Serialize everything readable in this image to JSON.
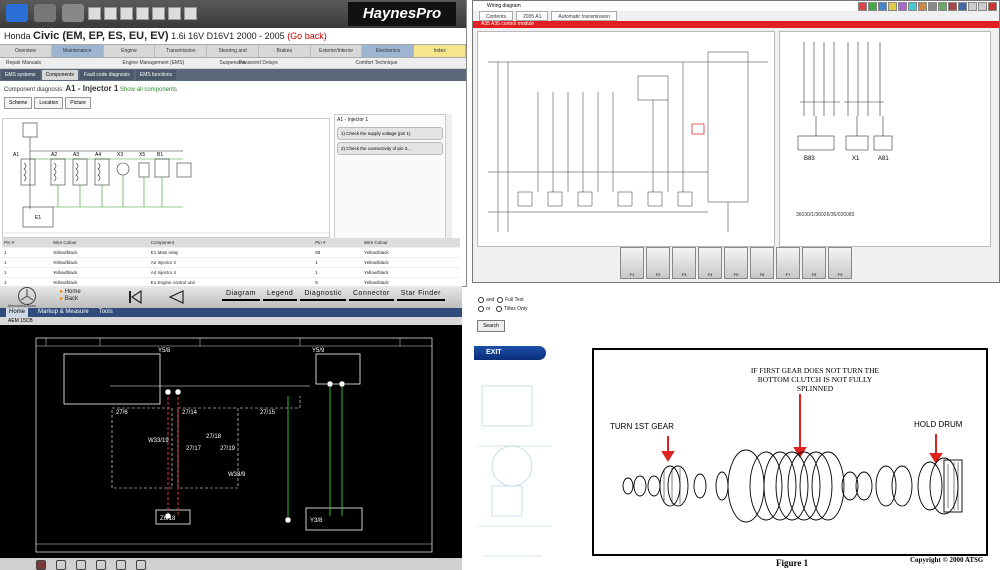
{
  "haynes": {
    "logo": "HaynesPro",
    "vehicle_prefix": "Honda",
    "vehicle_model": "Civic (EM, EP, ES, EU, EV)",
    "vehicle_detail": "1.6i 16V D16V1 2000 - 2005",
    "change_link": "(Go back)",
    "tabs": [
      "Overview",
      "Maintenance",
      "Engine",
      "Transmission",
      "Steering and Suspension",
      "Brakes",
      "Exterior/Interior",
      "Electronics",
      "Index"
    ],
    "subtabs": [
      "Repair Manuals",
      "Engine Management (EMS)",
      "Password Delays",
      "Comfort Technique"
    ],
    "subtabs2": [
      "EMS systems",
      "Components",
      "Fault code diagnosis",
      "EMS functions"
    ],
    "component_label": "Component diagnosis:",
    "component_value": "A1 - Injector 1",
    "show_all": "Show all components",
    "view_buttons": [
      "Scheme",
      "Location",
      "Picture"
    ],
    "diagram_labels": [
      "A1",
      "A2",
      "A3",
      "A4",
      "X3",
      "X5",
      "B1",
      "E1"
    ],
    "panel_title": "A1 - Injector 1",
    "steps": [
      "1) Check the supply voltage (pin 1)",
      "2) Check the connectivity of pin 3..."
    ],
    "table_header": [
      "Pin #",
      "Wire Colour",
      "Component",
      "Pin #",
      "Wire Colour"
    ],
    "table_rows": [
      [
        "1",
        "Yellow/black",
        "E1 Main relay",
        "85",
        "Yellow/black"
      ],
      [
        "1",
        "Yellow/black",
        "A2 Injector 2",
        "1",
        "Yellow/black"
      ],
      [
        "1",
        "Yellow/black",
        "A4 Injector 4",
        "1",
        "Yellow/black"
      ],
      [
        "1",
        "Yellow/black",
        "E1 Engine control unit",
        "5",
        "Yellow/black"
      ]
    ]
  },
  "wiring": {
    "window_title": "Wiring diagram",
    "tabs": [
      "Contents",
      "2005 A1",
      "Automatic transmission"
    ],
    "red_bar": "A35   A35 control module",
    "right_labels": [
      "B83",
      "X1",
      "A81"
    ],
    "code": "36030/1/36026/36/026083",
    "fn_keys": [
      "F1",
      "F2",
      "F3",
      "F4",
      "F5",
      "F6",
      "F7",
      "F8",
      "F9"
    ]
  },
  "mercedes": {
    "brand": "Mercedes-Benz",
    "nav_home": "Home",
    "nav_back": "Back",
    "tabs": [
      "Diagram",
      "Legend",
      "Diagnostic",
      "Connector",
      "Star Finder"
    ],
    "menu": [
      "Home",
      "Markup & Measure",
      "Tools"
    ],
    "title": "AEM 15CB",
    "labels": [
      "Y5/8",
      "Y5/9",
      "27/6",
      "27/14",
      "27/15",
      "27/17",
      "27/18",
      "27/19",
      "W33/19",
      "W33/9",
      "Z6/18",
      "Y3/8"
    ]
  },
  "sidebar": {
    "opt1": "and",
    "opt2": "Full Text",
    "opt3": "or",
    "opt4": "Titles Only",
    "search": "Search",
    "exit": "EXIT"
  },
  "atsg": {
    "note": "IF FIRST GEAR DOES NOT TURN THE BOTTOM CLUTCH IS NOT FULLY SPLINNED",
    "label_left": "TURN 1ST GEAR",
    "label_right": "HOLD DRUM",
    "caption": "Figure 1",
    "copyright": "Copyright © 2000 ATSG"
  },
  "colors": {
    "haynes_tab_active": "#9db5d1",
    "wiring_red": "#e02020",
    "mb_menu": "#2f4c7a",
    "exit_blue": "#1e4ea8",
    "wire_red": "#ff3333",
    "wire_green": "#33cc33"
  }
}
